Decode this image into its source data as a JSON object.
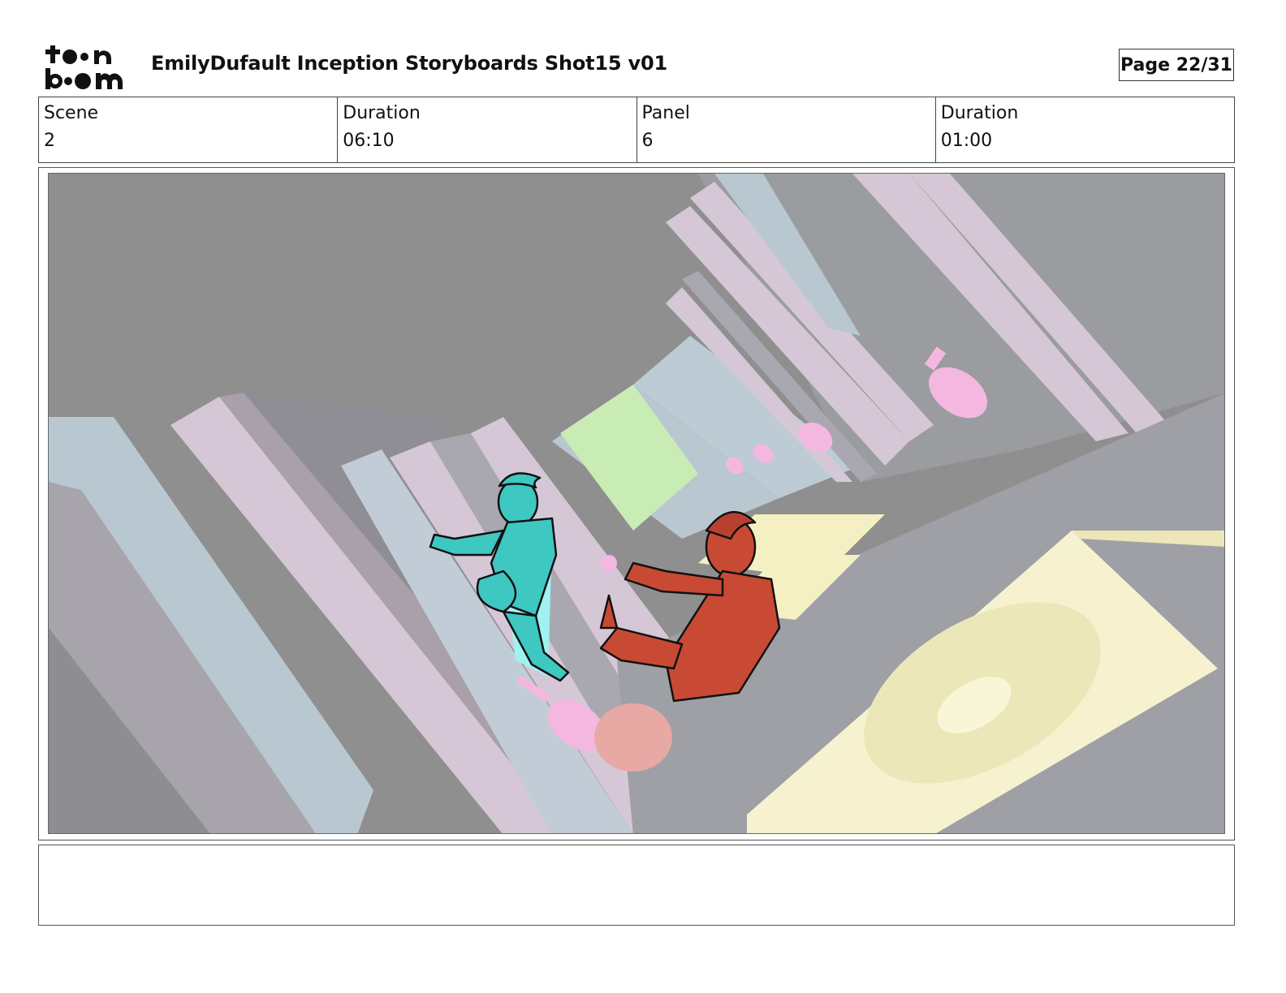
{
  "header": {
    "title": "EmilyDufault Inception Storyboards Shot15 v01",
    "page_label": "Page 22/31"
  },
  "info": {
    "scene_label": "Scene",
    "scene_value": "2",
    "scene_duration_label": "Duration",
    "scene_duration_value": "06:10",
    "panel_label": "Panel",
    "panel_value": "6",
    "panel_duration_label": "Duration",
    "panel_duration_value": "01:00"
  },
  "notes": {
    "text": ""
  },
  "colors": {
    "background_gray": "#8f8f8f",
    "wall_lilac": "#d8c8d8",
    "wall_blue": "#bccbd4",
    "floor_yellow": "#f4f0c4",
    "green_panel": "#c8ecb4",
    "teal_character": "#3fc7c2",
    "red_character": "#c84a34",
    "pink_props": "#f4b8e0"
  }
}
